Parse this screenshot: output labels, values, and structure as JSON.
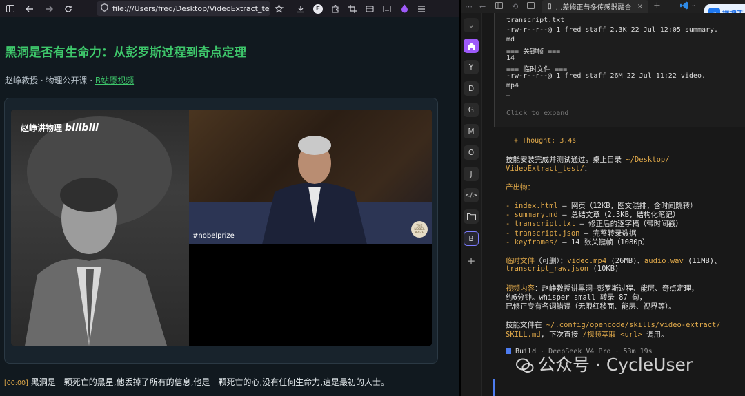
{
  "browser": {
    "url": "file:///Users/fred/Desktop/VideoExtract_test/",
    "profile_badge": "F"
  },
  "page": {
    "title": "黑洞是否有生命力：从彭罗斯过程到奇点定理",
    "meta_text": "赵峥教授 · 物理公开课 · ",
    "meta_link": "B站原视频",
    "video": {
      "channel_label": "赵峥讲物理",
      "channel_brand": "bilibili",
      "nobel_hashtag": "#nobelprize",
      "nobel_logo": "THE NOBEL PRIZE"
    },
    "subtitle_time": "[00:00]",
    "subtitle_text": "黑洞是一颗死亡的黑星,他丢掉了所有的信息,他是一颗死亡的心,没有任何生命力,這是最初的人士。"
  },
  "app": {
    "tab_title": "…差修正与多传感器融合",
    "badge": "拖拽丢",
    "sidebar": [
      "Y",
      "D",
      "G",
      "M",
      "O",
      "J",
      "</>",
      "B"
    ],
    "terminal": {
      "l1": "transcript.txt",
      "l2": "-rw-r--r--@ 1 fred  staff   2.3K 22 Jul 12:05 summary.",
      "l3": "md",
      "l4": "=== 关键帧 ===",
      "l5": "      14",
      "l6": "=== 临时文件 ===",
      "l7": "-rw-r--r--@ 1 fred  staff    26M 22 Jul 11:22 video.",
      "l8": "mp4",
      "l9": "…",
      "expand": "Click to expand"
    },
    "thought": "+ Thought: 3.4s",
    "response": {
      "p1a": "技能安装完成并测试通过。桌上目录 ",
      "p1b": "~/Desktop/",
      "p1c": "VideoExtract_test/",
      "p1d": "：",
      "outputs_heading": "产出物：",
      "o1a": "- ",
      "o1b": "index.html",
      "o1c": " — 网页（12KB，图文混排，含时间跳转）",
      "o2a": "- ",
      "o2b": "summary.md",
      "o2c": " — 总结文章（2.3KB，结构化笔记）",
      "o3a": "- ",
      "o3b": "transcript.txt",
      "o3c": " — 修正后的逐字稿（带时间戳）",
      "o4a": "- ",
      "o4b": "transcript.json",
      "o4c": " — 完整转录数据",
      "o5a": "- ",
      "o5b": "keyframes/",
      "o5c": " — 14 张关键帧（1080p）",
      "tmp_a": "临时文件",
      "tmp_b": "（可删）：",
      "tmp_c": "video.mp4",
      "tmp_d": " (26MB)、",
      "tmp_e": "audio.wav",
      "tmp_f": " (11MB)、",
      "tmp_g": "transcript_raw.json",
      "tmp_h": " (10KB)",
      "vid_a": "视频内容",
      "vid_b": "：赵峥教授讲黑洞—彭罗斯过程、能层、奇点定理，",
      "vid_c": "约6分钟。whisper small 转录 87 句，",
      "vid_d": "已修正专有名词错误（无限红移面、能层、视界等）。",
      "skill_a": "技能文件在 ",
      "skill_b": "~/.config/opencode/skills/video-extract/",
      "skill_c": "SKILL.md",
      "skill_d": ", 下次直接 ",
      "skill_e": "/视频萃取 <url>",
      "skill_f": " 调用。"
    },
    "build": {
      "label": "Build",
      "rest": " · DeepSeek V4 Pro · 53m 19s"
    }
  },
  "watermark": "公众号 · CycleUser",
  "colors": {
    "accent_green": "#3ec76b",
    "accent_orange": "#e0a94a",
    "accent_purple": "#9e5afa",
    "accent_blue": "#4d7cf0"
  }
}
